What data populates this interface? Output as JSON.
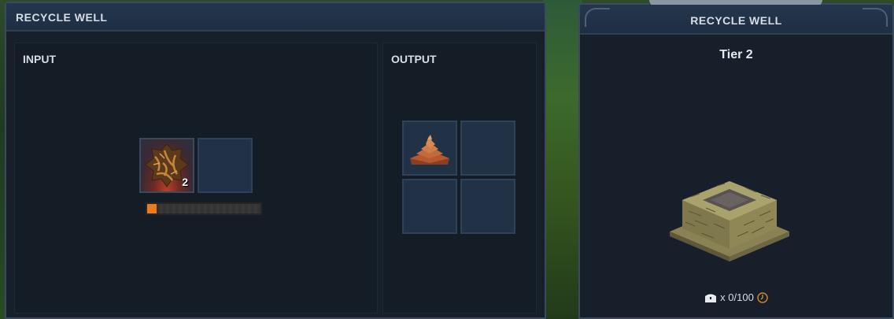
{
  "left_panel": {
    "title": "RECYCLE WELL",
    "input": {
      "label": "INPUT",
      "slots": [
        {
          "item": "rusty-scrap-icon",
          "qty": "2"
        },
        {
          "item": null,
          "qty": ""
        }
      ],
      "progress": 0.08
    },
    "output": {
      "label": "OUTPUT",
      "slots": [
        {
          "item": "clay-pile-icon"
        },
        {
          "item": null
        },
        {
          "item": null
        },
        {
          "item": null
        }
      ]
    }
  },
  "right_panel": {
    "title": "RECYCLE WELL",
    "tier": "Tier 2",
    "capacity": "x 0/100",
    "icons": [
      "chest-icon",
      "clock-icon"
    ]
  },
  "colors": {
    "accent_orange": "#f07a1a",
    "panel_bg": "#161f2a",
    "slot_bg": "#223246"
  }
}
